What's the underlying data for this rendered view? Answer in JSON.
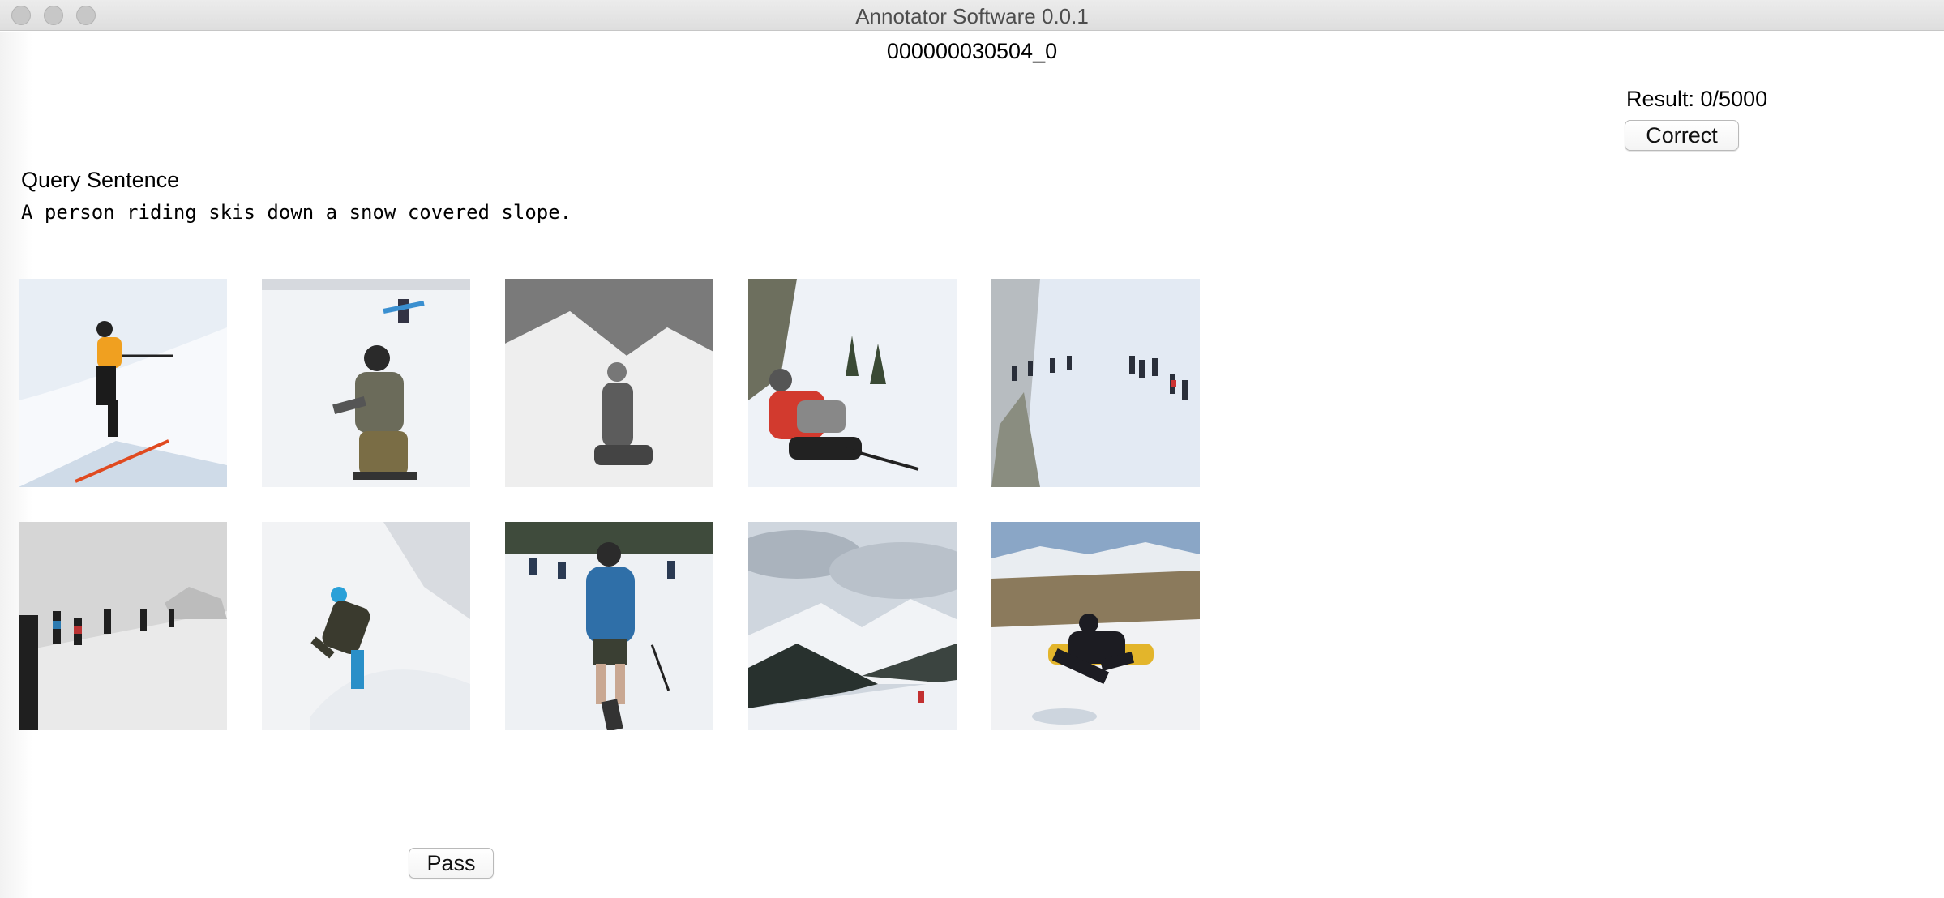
{
  "window": {
    "title": "Annotator Software 0.0.1",
    "controls": [
      "close-icon",
      "minimize-icon",
      "maximize-icon"
    ]
  },
  "item_id": "000000030504_0",
  "result": {
    "text": "Result: 0/5000",
    "correct_label": "Correct"
  },
  "query": {
    "label": "Query Sentence",
    "sentence": "A person riding skis down a snow covered slope."
  },
  "pass_label": "Pass"
}
